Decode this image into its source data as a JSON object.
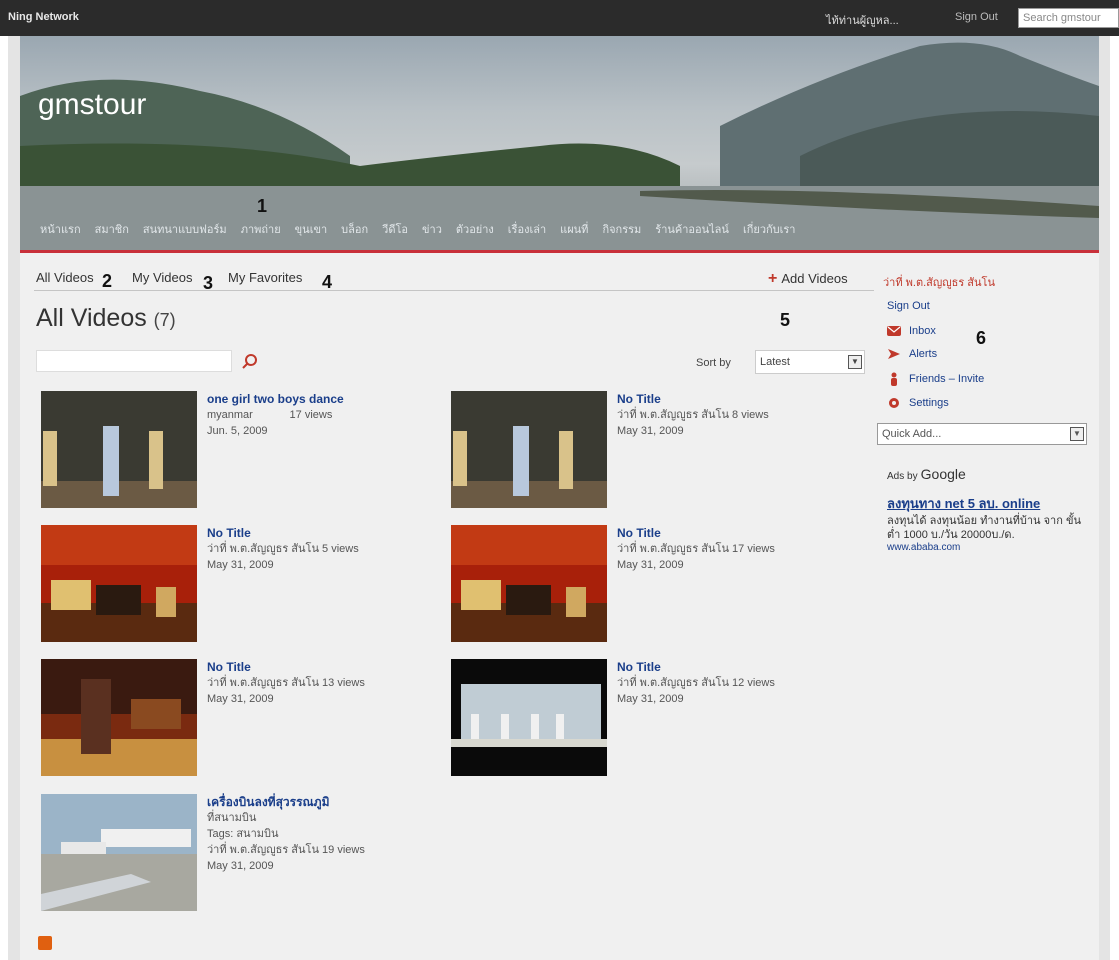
{
  "topbar": {
    "brand": "Ning Network",
    "user": "ไท้ท่านผู้ญูหล...",
    "signout": "Sign Out",
    "search_placeholder": "Search gmstour"
  },
  "site": {
    "title": "gmstour",
    "nav": [
      "หน้าแรก",
      "สมาชิก",
      "สนทนาแบบฟอร์ม",
      "ภาพถ่าย",
      "ขุนเขา",
      "บล็อก",
      "วีดีโอ",
      "ข่าว",
      "ตัวอย่าง",
      "เรื่องเล่า",
      "แผนที่",
      "กิจกรรม",
      "ร้านค้าออนไลน์",
      "เกี่ยวกับเรา"
    ]
  },
  "tabs": {
    "all": "All Videos",
    "mine": "My Videos",
    "favorites": "My Favorites",
    "add": "Add Videos",
    "user_link": "ว่าที่ พ.ต.สัญญูธร สันโน"
  },
  "markers": [
    "1",
    "2",
    "3",
    "4",
    "5",
    "6"
  ],
  "heading": {
    "title": "All Videos",
    "count": "(7)"
  },
  "sort": {
    "label": "Sort by",
    "value": "Latest"
  },
  "videos": [
    {
      "title": "one girl two boys dance",
      "author": "myanmar",
      "views": "17 views",
      "date": "Jun. 5, 2009"
    },
    {
      "title": "No Title",
      "author": "ว่าที่ พ.ต.สัญญูธร สันโน",
      "views": "8 views",
      "date": "May 31, 2009"
    },
    {
      "title": "No Title",
      "author": "ว่าที่ พ.ต.สัญญูธร สันโน",
      "views": "5 views",
      "date": "May 31, 2009"
    },
    {
      "title": "No Title",
      "author": "ว่าที่ พ.ต.สัญญูธร สันโน",
      "views": "17 views",
      "date": "May 31, 2009"
    },
    {
      "title": "No Title",
      "author": "ว่าที่ พ.ต.สัญญูธร สันโน",
      "views": "13 views",
      "date": "May 31, 2009"
    },
    {
      "title": "No Title",
      "author": "ว่าที่ พ.ต.สัญญูธร สันโน",
      "views": "12 views",
      "date": "May 31, 2009"
    },
    {
      "title": "เครื่องบินลงที่สุวรรณภูมิ",
      "subtitle": "ที่สนามบิน",
      "tags": "Tags: สนามบิน",
      "author": "ว่าที่ พ.ต.สัญญูธร สันโน",
      "views": "19 views",
      "date": "May 31, 2009"
    }
  ],
  "sidebar": {
    "signout": "Sign Out",
    "inbox": "Inbox",
    "alerts": "Alerts",
    "friends": "Friends – Invite",
    "settings": "Settings",
    "quickadd": "Quick Add..."
  },
  "ads": {
    "adsby": "Ads by",
    "google": "Google",
    "title": "ลงทุนทาง net 5 ลบ. online",
    "body": "ลงทุนได้ ลงทุนน้อย ทำงานที่บ้าน จาก ขั้นต่ำ 1000 บ./วัน 20000บ./ด.",
    "url": "www.ababa.com"
  },
  "colors": {
    "accent": "#c8303a",
    "link": "#1a3e8a",
    "topbar": "#2b2b2b"
  }
}
